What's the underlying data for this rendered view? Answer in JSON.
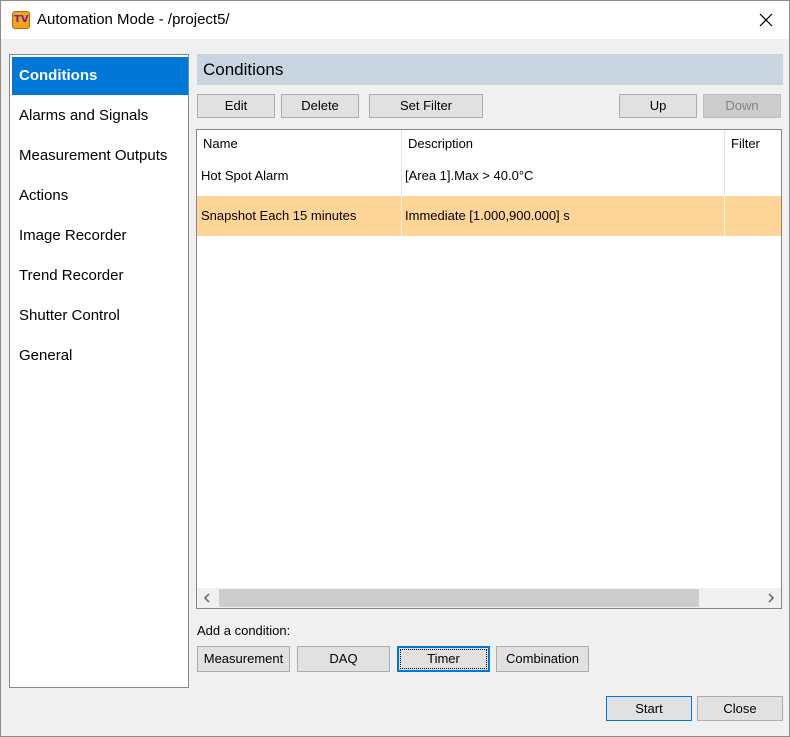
{
  "window": {
    "title": "Automation Mode - /project5/",
    "app_icon_text": "TV"
  },
  "sidebar": {
    "items": [
      {
        "label": "Conditions",
        "active": true
      },
      {
        "label": "Alarms and Signals"
      },
      {
        "label": "Measurement Outputs"
      },
      {
        "label": "Actions"
      },
      {
        "label": "Image Recorder"
      },
      {
        "label": "Trend Recorder"
      },
      {
        "label": "Shutter Control"
      },
      {
        "label": "General"
      }
    ]
  },
  "panel": {
    "title": "Conditions"
  },
  "toolbar": {
    "edit": "Edit",
    "delete": "Delete",
    "set_filter": "Set Filter",
    "up": "Up",
    "down": "Down"
  },
  "table": {
    "columns": [
      "Name",
      "Description",
      "Filter"
    ],
    "rows": [
      {
        "name": "Hot Spot Alarm",
        "description": "[Area 1].Max > 40.0°C",
        "filter": ""
      },
      {
        "name": "Snapshot Each 15 minutes",
        "description": "Immediate [1.000,900.000] s",
        "filter": "",
        "selected": true
      }
    ]
  },
  "add_condition": {
    "label": "Add a condition:",
    "buttons": [
      "Measurement",
      "DAQ",
      "Timer",
      "Combination"
    ]
  },
  "footer": {
    "start": "Start",
    "close": "Close"
  },
  "colors": {
    "selection": "#ffd597",
    "sidebar_active": "#0078d7",
    "header_band": "#c8d4e0"
  }
}
